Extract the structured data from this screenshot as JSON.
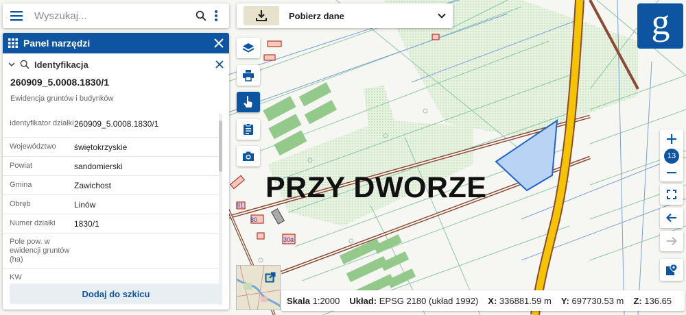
{
  "search": {
    "placeholder": "Wyszukaj..."
  },
  "panel": {
    "title": "Panel narzędzi",
    "section": "Identyfikacja",
    "parcel_id": "260909_5.0008.1830/1",
    "subtitle": "Ewidencja gruntów i budynków",
    "attributes": [
      {
        "key": "Identyfikator działki",
        "value": "260909_5.0008.1830/1"
      },
      {
        "key": "Województwo",
        "value": "świętokrzyskie"
      },
      {
        "key": "Powiat",
        "value": "sandomierski"
      },
      {
        "key": "Gmina",
        "value": "Zawichost"
      },
      {
        "key": "Obręb",
        "value": "Linów"
      },
      {
        "key": "Numer działki",
        "value": "1830/1"
      },
      {
        "key": "Pole pow. w ewidencji gruntów (ha)",
        "value": ""
      },
      {
        "key": "KW",
        "value": ""
      }
    ],
    "add_sketch": "Dodaj do szkicu"
  },
  "download": {
    "label": "Pobierz dane"
  },
  "map": {
    "place_label": "PRZY DWORZE",
    "parcel_numbers": [
      "81",
      "80",
      "30a"
    ],
    "zoom_level": "13",
    "logo_letter": "g"
  },
  "status": {
    "scale_label": "Skala",
    "scale_value": "1:2000",
    "crs_label": "Układ:",
    "crs_value": "EPSG 2180 (układ 1992)",
    "x_label": "X:",
    "x_value": "336881.59 m",
    "y_label": "Y:",
    "y_value": "697730.53 m",
    "z_label": "Z:",
    "z_value": "136.65"
  },
  "colors": {
    "brand": "#0d55a0",
    "road": "#f4c400",
    "selection": "#1e64c8"
  }
}
